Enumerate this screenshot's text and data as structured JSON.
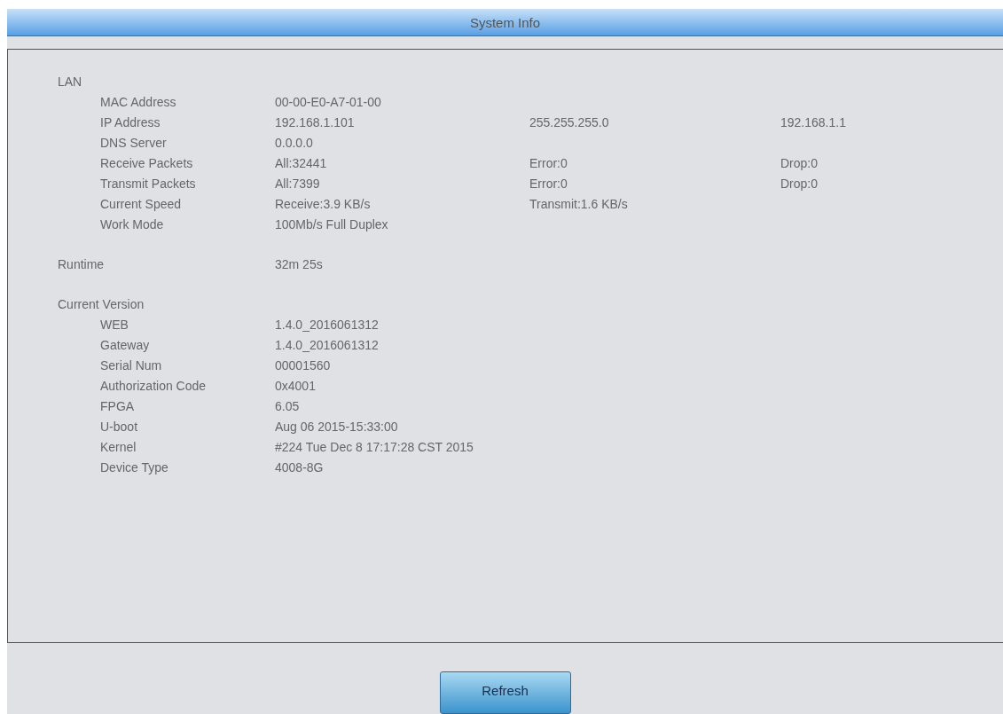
{
  "header": {
    "title": "System Info"
  },
  "sections": [
    {
      "title": "LAN",
      "rows": [
        {
          "label": "MAC Address",
          "values": [
            "00-00-E0-A7-01-00"
          ]
        },
        {
          "label": "IP Address",
          "values": [
            "192.168.1.101",
            "255.255.255.0",
            "192.168.1.1"
          ]
        },
        {
          "label": "DNS Server",
          "values": [
            "0.0.0.0"
          ]
        },
        {
          "label": "Receive Packets",
          "values": [
            "All:32441",
            "Error:0",
            "Drop:0"
          ]
        },
        {
          "label": "Transmit Packets",
          "values": [
            "All:7399",
            "Error:0",
            "Drop:0"
          ]
        },
        {
          "label": "Current Speed",
          "values": [
            "Receive:3.9 KB/s",
            "Transmit:1.6 KB/s"
          ]
        },
        {
          "label": "Work Mode",
          "values": [
            "100Mb/s Full Duplex"
          ]
        }
      ]
    },
    {
      "title": "Runtime",
      "value": "32m 25s"
    },
    {
      "title": "Current Version",
      "rows": [
        {
          "label": "WEB",
          "values": [
            "1.4.0_2016061312"
          ]
        },
        {
          "label": "Gateway",
          "values": [
            "1.4.0_2016061312"
          ]
        },
        {
          "label": "Serial Num",
          "values": [
            "00001560"
          ]
        },
        {
          "label": "Authorization Code",
          "values": [
            "0x4001"
          ]
        },
        {
          "label": "FPGA",
          "values": [
            "6.05"
          ]
        },
        {
          "label": "U-boot",
          "values": [
            "Aug 06 2015-15:33:00"
          ]
        },
        {
          "label": "Kernel",
          "values": [
            "#224 Tue Dec 8 17:17:28 CST 2015"
          ]
        },
        {
          "label": "Device Type",
          "values": [
            "4008-8G"
          ]
        }
      ]
    }
  ],
  "buttons": [
    {
      "label": "Refresh"
    }
  ]
}
